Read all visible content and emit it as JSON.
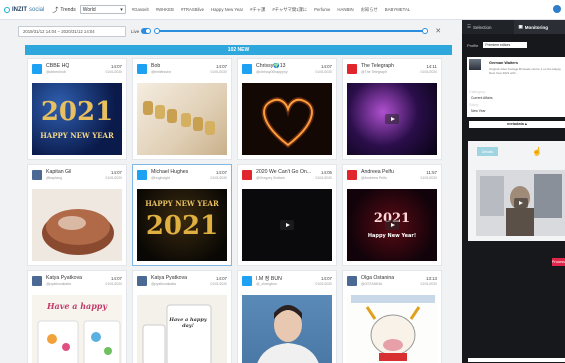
{
  "app": {
    "logo": "INZIT",
    "logo_sub": "social",
    "trends_label": "Trends",
    "region": "World"
  },
  "tags": [
    "#Gasselt",
    "#WHKEB",
    "#TRASBlive",
    "Happy New Year",
    "#チャ課",
    "#チャサマ間1課に",
    "Perfume",
    "HANBIN",
    "お知らせ",
    "BABYMETAL"
  ],
  "datebar": {
    "range": "2019/31/12 14:04  –  2020/31/12 14:04",
    "live_label": "Live"
  },
  "banner": {
    "label": "102 NEW"
  },
  "cards": [
    {
      "name": "CBBE HQ",
      "handle": "@cbbeohiob",
      "time": "14:07",
      "date": "01/01/2020",
      "source": "twitter"
    },
    {
      "name": "Bob",
      "handle": "@limitlesstxx",
      "time": "14:07",
      "date": "01/01/2020",
      "source": "twitter"
    },
    {
      "name": "Chrissy🌍13",
      "handle": "@chrissy00happyny",
      "time": "14:07",
      "date": "01/01/2020",
      "source": "twitter"
    },
    {
      "name": "The Telegraph",
      "handle": "@The Telegraph",
      "time": "14:11",
      "date": "01/01/2020",
      "source": "youtube"
    },
    {
      "name": "Kapitan Gil",
      "handle": "@kaptang",
      "time": "14:07",
      "date": "01/01/2020",
      "source": "vk"
    },
    {
      "name": "Michael Hughes",
      "handle": "@hughsight",
      "time": "14:07",
      "date": "01/01/2020",
      "source": "twitter"
    },
    {
      "name": "2020 We Can't Go On...",
      "handle": "@Gregory Smitain",
      "time": "14:05",
      "date": "01/01/2020",
      "source": "youtube"
    },
    {
      "name": "Andreea Pelfu",
      "handle": "@Andreea Pelfu",
      "time": "11:57",
      "date": "01/01/2020",
      "source": "youtube"
    },
    {
      "name": "Katya Pyatkova",
      "handle": "@pyatkovakatia",
      "time": "14:07",
      "date": "01/01/2020",
      "source": "vk"
    },
    {
      "name": "Katya Pyatkova",
      "handle": "@pyatkovakatia",
      "time": "14:07",
      "date": "01/01/2020",
      "source": "vk"
    },
    {
      "name": "I.M 정 BUN",
      "handle": "@_zhangbun",
      "time": "14:07",
      "date": "01/01/2020",
      "source": "twitter"
    },
    {
      "name": "Olga Ostanina",
      "handle": "@OSTANINA",
      "time": "13:13",
      "date": "01/01/2020",
      "source": "vk"
    }
  ],
  "media_text": {
    "card0_title": "2021",
    "card0_sub": "HAPPY NEW YEAR",
    "card5_title": "HAPPY NEW YEAR",
    "card5_year": "2021",
    "card7_year": "2021",
    "card7_sub": "Happy New Year!",
    "card8_text": "Have a happy",
    "card9_text": "Have a happy day!"
  },
  "panel": {
    "tab_selection": "Selection",
    "tab_monitoring": "Monitoring",
    "profile_label": "Profile",
    "profile_value": "Premiere editors",
    "preview_name": "German Walters",
    "preview_text": "Original video footage Brussels centre 1 on the Happy New Year 2021 with ...",
    "category_label": "Category",
    "category_value": "Current Affairs",
    "story_label": "Story",
    "story_value": "New Year",
    "metadata_label": "metadata",
    "box_button": "Details",
    "red_button": "Process"
  },
  "colors": {
    "accent": "#2ea7dc",
    "background": "#1ec9cf",
    "twitter": "#1da1f2",
    "youtube": "#e0262c",
    "vk": "#4a6a95"
  }
}
